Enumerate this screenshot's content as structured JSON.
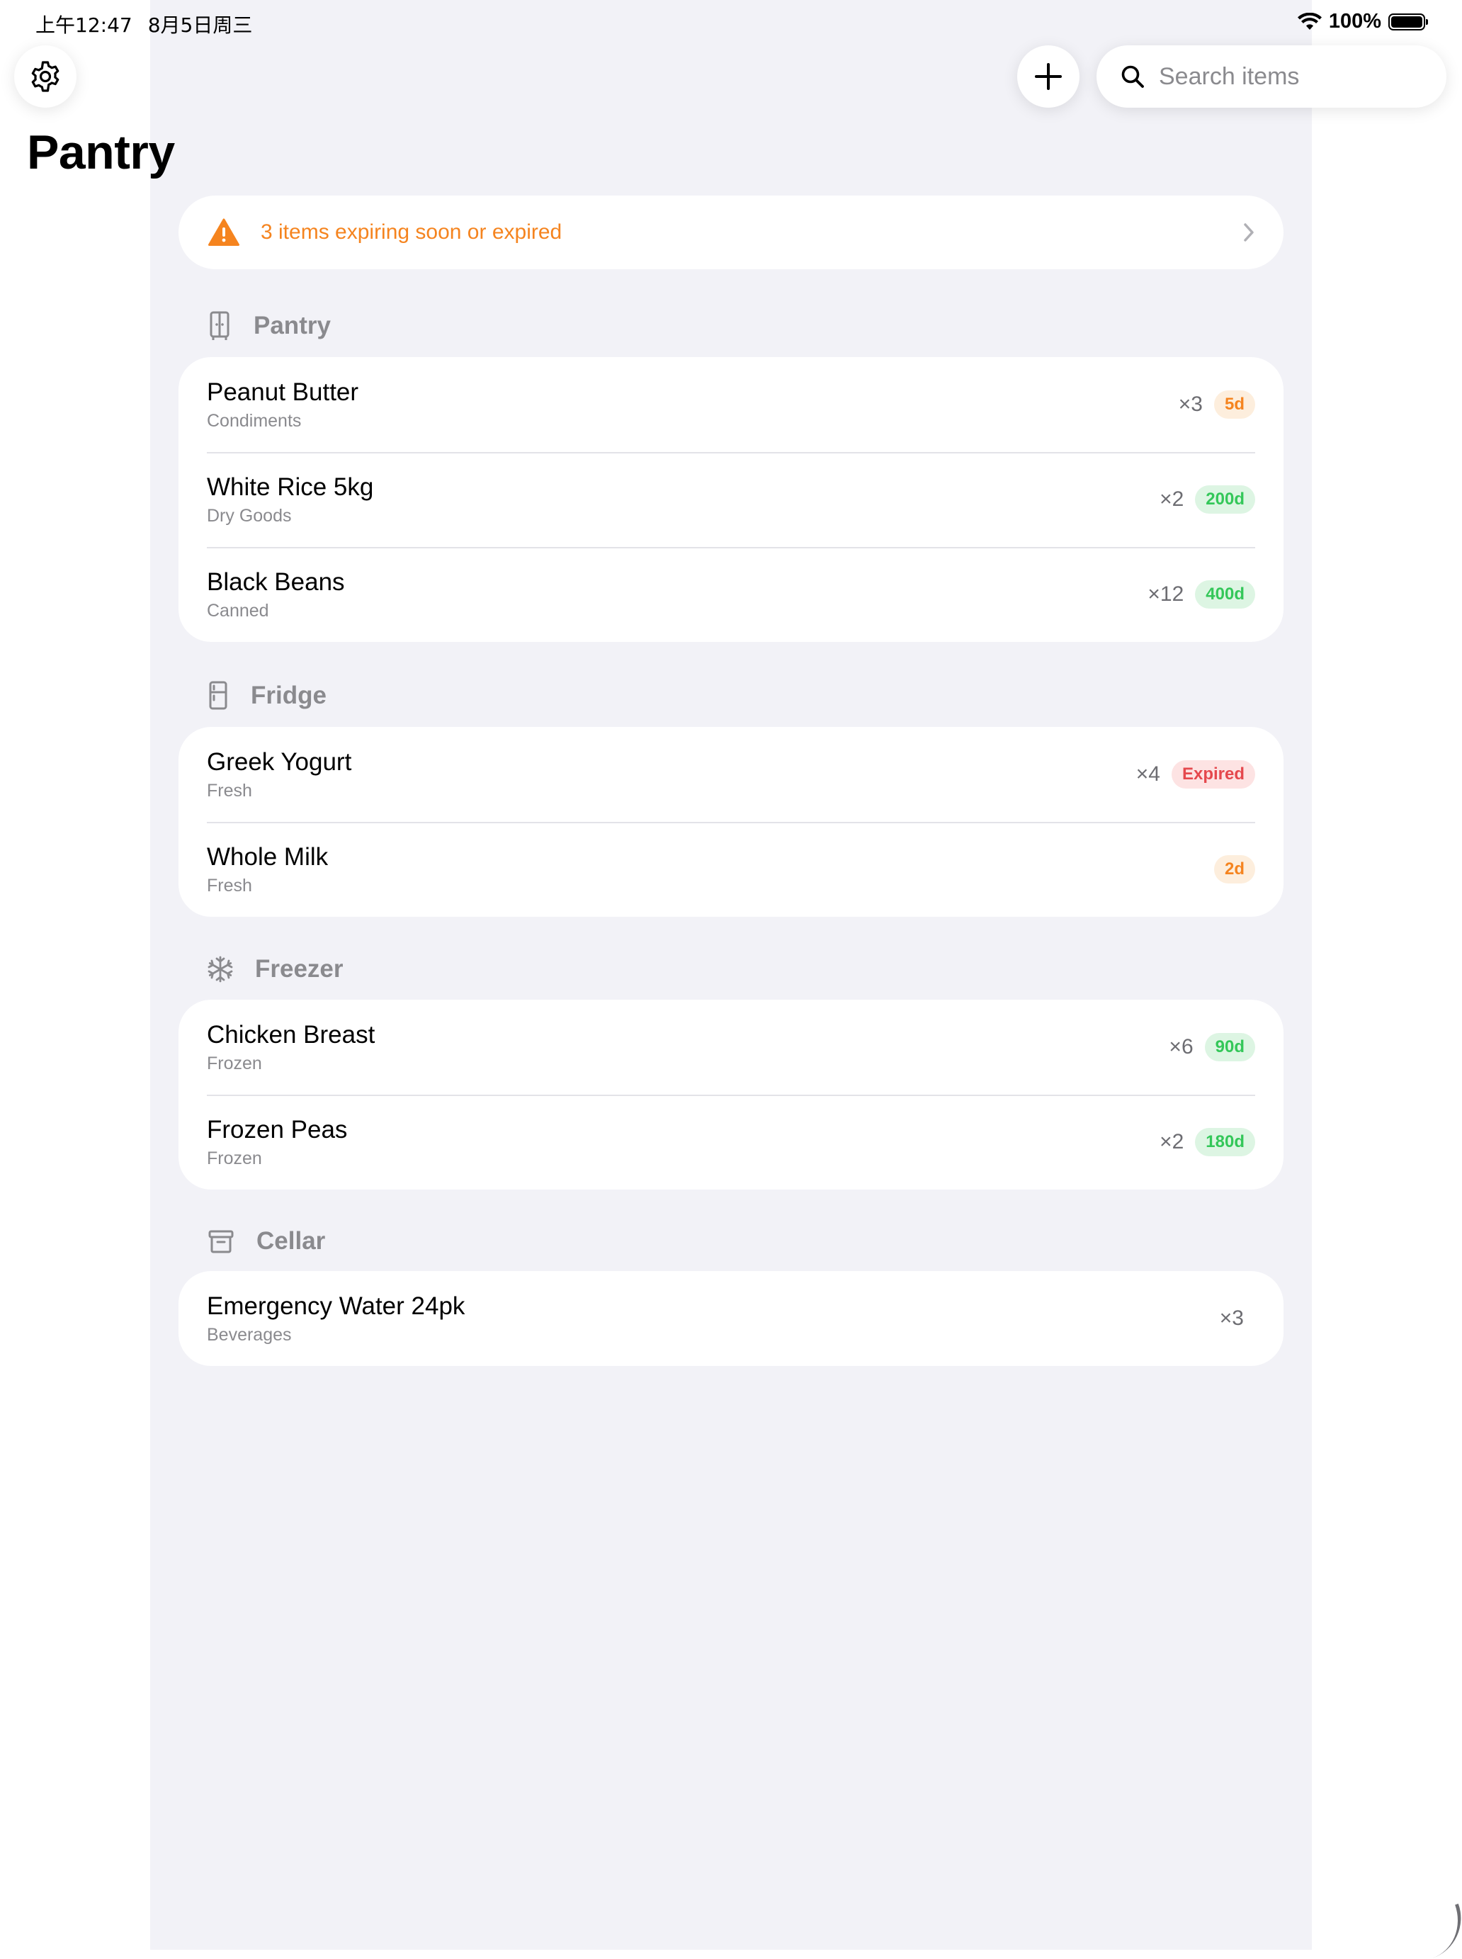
{
  "status_bar": {
    "time": "上午12:47",
    "date": "8月5日周三",
    "battery_percent": "100%",
    "battery_level": 1.0
  },
  "toolbar": {
    "settings_icon": "gear-icon",
    "add_icon": "plus-icon",
    "search_icon": "magnifying-glass-icon",
    "search_placeholder": "Search items",
    "search_value": ""
  },
  "page_title": "Pantry",
  "alert": {
    "icon": "warning-triangle-icon",
    "text": "3 items expiring soon or expired",
    "color": "#f5841f"
  },
  "sections": [
    {
      "title": "Pantry",
      "icon": "cabinet-icon",
      "items": [
        {
          "name": "Peanut Butter",
          "category": "Condiments",
          "qty": "×3",
          "badge": "5d",
          "badge_color": "orange"
        },
        {
          "name": "White Rice 5kg",
          "category": "Dry Goods",
          "qty": "×2",
          "badge": "200d",
          "badge_color": "green"
        },
        {
          "name": "Black Beans",
          "category": "Canned",
          "qty": "×12",
          "badge": "400d",
          "badge_color": "green"
        }
      ]
    },
    {
      "title": "Fridge",
      "icon": "refrigerator-icon",
      "items": [
        {
          "name": "Greek Yogurt",
          "category": "Fresh",
          "qty": "×4",
          "badge": "Expired",
          "badge_color": "red"
        },
        {
          "name": "Whole Milk",
          "category": "Fresh",
          "qty": "",
          "badge": "2d",
          "badge_color": "orange"
        }
      ]
    },
    {
      "title": "Freezer",
      "icon": "snowflake-icon",
      "items": [
        {
          "name": "Chicken Breast",
          "category": "Frozen",
          "qty": "×6",
          "badge": "90d",
          "badge_color": "green"
        },
        {
          "name": "Frozen Peas",
          "category": "Frozen",
          "qty": "×2",
          "badge": "180d",
          "badge_color": "green"
        }
      ]
    },
    {
      "title": "Cellar",
      "icon": "archive-box-icon",
      "items": [
        {
          "name": "Emergency Water 24pk",
          "category": "Beverages",
          "qty": "×3",
          "badge": "",
          "badge_color": ""
        }
      ]
    }
  ],
  "colors": {
    "background": "#f2f2f7",
    "expiring": "#f5841f",
    "fresh": "#34c759",
    "expired": "#e5484d",
    "secondary_text": "#8a8a8e"
  }
}
